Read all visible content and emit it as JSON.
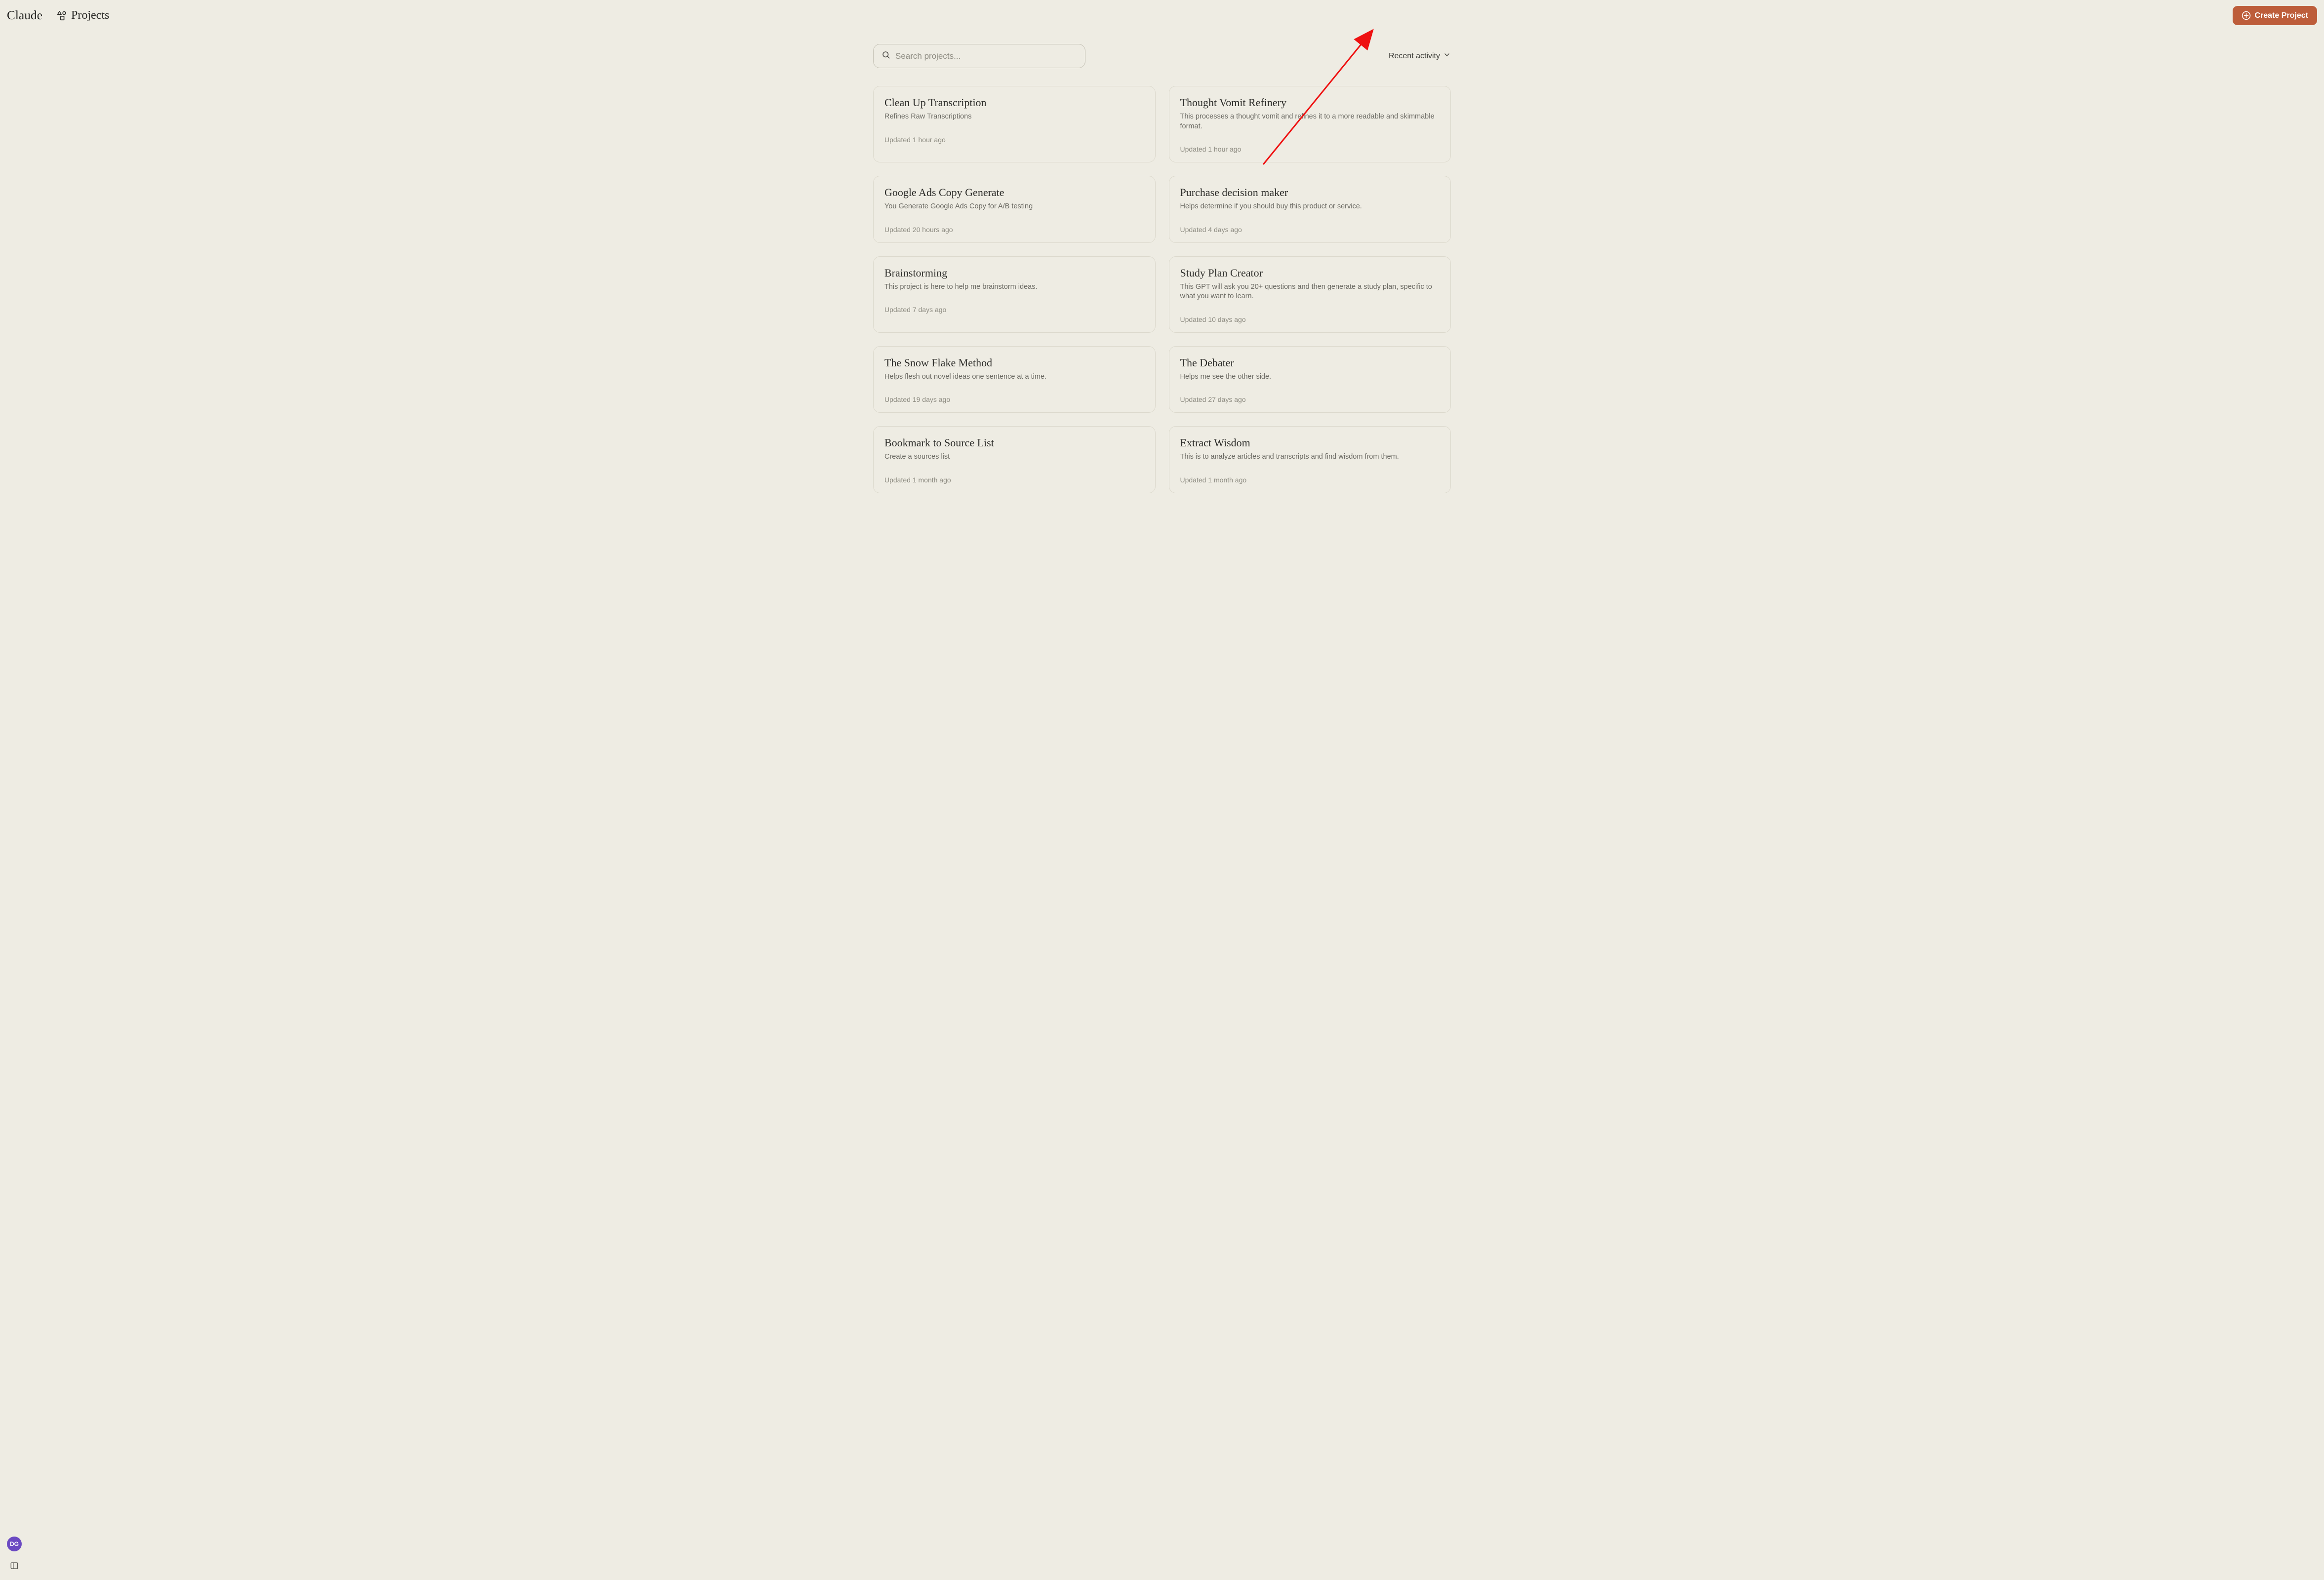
{
  "brand": "Claude",
  "page_title": "Projects",
  "create_button_label": "Create Project",
  "search": {
    "placeholder": "Search projects..."
  },
  "sort": {
    "label": "Recent activity"
  },
  "avatar_initials": "DG",
  "projects": [
    {
      "title": "Clean Up Transcription",
      "desc": "Refines Raw Transcriptions",
      "updated": "Updated 1 hour ago"
    },
    {
      "title": "Thought Vomit Refinery",
      "desc": "This processes a thought vomit and refines it to a more readable and skimmable format.",
      "updated": "Updated 1 hour ago"
    },
    {
      "title": "Google Ads Copy Generate",
      "desc": "You Generate Google Ads Copy for A/B testing",
      "updated": "Updated 20 hours ago"
    },
    {
      "title": "Purchase decision maker",
      "desc": "Helps determine if you should buy this product or service.",
      "updated": "Updated 4 days ago"
    },
    {
      "title": "Brainstorming",
      "desc": "This project is here to help me brainstorm ideas.",
      "updated": "Updated 7 days ago"
    },
    {
      "title": "Study Plan Creator",
      "desc": "This GPT will ask you 20+ questions and then generate a study plan, specific to what you want to learn.",
      "updated": "Updated 10 days ago"
    },
    {
      "title": "The Snow Flake Method",
      "desc": "Helps flesh out novel ideas one sentence at a time.",
      "updated": "Updated 19 days ago"
    },
    {
      "title": "The Debater",
      "desc": "Helps me see the other side.",
      "updated": "Updated 27 days ago"
    },
    {
      "title": "Bookmark to Source List",
      "desc": "Create a sources list",
      "updated": "Updated 1 month ago"
    },
    {
      "title": "Extract Wisdom",
      "desc": "This is to analyze articles and transcripts and find wisdom from them.",
      "updated": "Updated 1 month ago"
    }
  ]
}
